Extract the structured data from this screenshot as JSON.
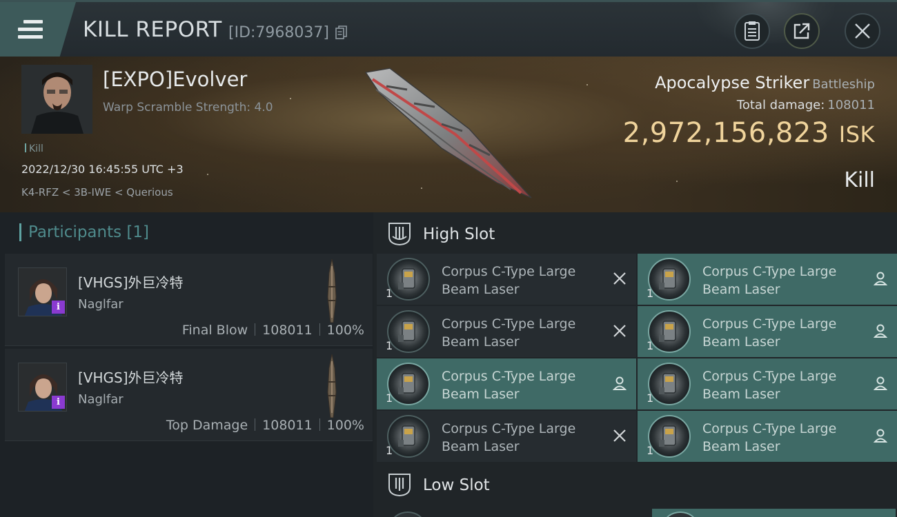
{
  "header": {
    "title": "KILL REPORT",
    "report_id": "[ID:7968037]"
  },
  "victim": {
    "name": "[EXPO]Evolver",
    "warp_scramble": "Warp Scramble Strength: 4.0",
    "kill_tag": "Kill",
    "datetime": "2022/12/30 16:45:55 UTC +3",
    "location": "K4-RFZ < 3B-IWE < Querious",
    "ship": "Apocalypse Striker",
    "ship_class": "Battleship",
    "total_damage_label": "Total damage:",
    "total_damage": "108011",
    "isk_value": "2,972,156,823",
    "isk_unit": "ISK",
    "result": "Kill"
  },
  "participants": {
    "title": "Participants [1]",
    "rows": [
      {
        "name": "[VHGS]外巨冷特",
        "ship": "Naglfar",
        "role": "Final Blow",
        "damage": "108011",
        "percent": "100%",
        "badge": "i"
      },
      {
        "name": "[VHGS]外巨冷特",
        "ship": "Naglfar",
        "role": "Top Damage",
        "damage": "108011",
        "percent": "100%",
        "badge": "i"
      }
    ]
  },
  "slots": {
    "high_label": "High Slot",
    "low_label": "Low Slot",
    "high_modules": [
      {
        "line1": "Corpus C-Type Large",
        "line2": "Beam Laser",
        "qty": "1",
        "state": "destroyed"
      },
      {
        "line1": "Corpus C-Type Large",
        "line2": "Beam Laser",
        "qty": "1",
        "state": "dropped"
      },
      {
        "line1": "Corpus C-Type Large",
        "line2": "Beam Laser",
        "qty": "1",
        "state": "destroyed"
      },
      {
        "line1": "Corpus C-Type Large",
        "line2": "Beam Laser",
        "qty": "1",
        "state": "dropped"
      },
      {
        "line1": "Corpus C-Type Large",
        "line2": "Beam Laser",
        "qty": "1",
        "state": "dropped"
      },
      {
        "line1": "Corpus C-Type Large",
        "line2": "Beam Laser",
        "qty": "1",
        "state": "dropped"
      },
      {
        "line1": "Corpus C-Type Large",
        "line2": "Beam Laser",
        "qty": "1",
        "state": "destroyed"
      },
      {
        "line1": "Corpus C-Type Large",
        "line2": "Beam Laser",
        "qty": "1",
        "state": "dropped"
      }
    ]
  },
  "colors": {
    "accent_teal": "#3f6a66",
    "isk_gold": "#f0d49c",
    "participants_title": "#4f8b8c",
    "badge_purple": "#8a3ad0"
  },
  "icons": {
    "menu": "menu-icon",
    "copy": "copy-icon",
    "clipboard": "clipboard-icon",
    "share": "share-icon",
    "close": "close-icon",
    "destroyed": "x-icon",
    "dropped": "person-icon",
    "high_slot": "high-slot-icon",
    "low_slot": "low-slot-icon"
  }
}
